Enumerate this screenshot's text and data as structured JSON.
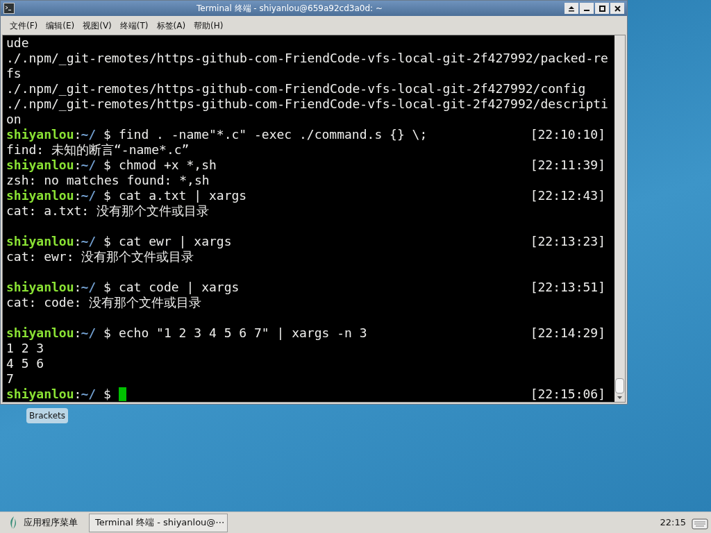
{
  "window": {
    "title": "Terminal 终端 - shiyanlou@659a92cd3a0d: ~"
  },
  "menu": [
    "文件(F)",
    "编辑(E)",
    "视图(V)",
    "终端(T)",
    "标签(A)",
    "帮助(H)"
  ],
  "terminal": {
    "lines": [
      {
        "kind": "output",
        "text": "ude"
      },
      {
        "kind": "output",
        "text": "./.npm/_git-remotes/https-github-com-FriendCode-vfs-local-git-2f427992/packed-re"
      },
      {
        "kind": "output",
        "text": "fs"
      },
      {
        "kind": "output",
        "text": "./.npm/_git-remotes/https-github-com-FriendCode-vfs-local-git-2f427992/config"
      },
      {
        "kind": "output",
        "text": "./.npm/_git-remotes/https-github-com-FriendCode-vfs-local-git-2f427992/descripti"
      },
      {
        "kind": "output",
        "text": "on"
      },
      {
        "kind": "prompt",
        "user": "shiyanlou",
        "sep": ":",
        "path": "~/",
        "sign": "$",
        "command": "find . -name\"*.c\" -exec ./command.s {} \\;",
        "time": "[22:10:10]"
      },
      {
        "kind": "output",
        "text": "find: 未知的断言“-name*.c”"
      },
      {
        "kind": "prompt",
        "user": "shiyanlou",
        "sep": ":",
        "path": "~/",
        "sign": "$",
        "command": "chmod +x *,sh",
        "time": "[22:11:39]"
      },
      {
        "kind": "output",
        "text": "zsh: no matches found: *,sh"
      },
      {
        "kind": "prompt",
        "user": "shiyanlou",
        "sep": ":",
        "path": "~/",
        "sign": "$",
        "command": "cat a.txt | xargs",
        "time": "[22:12:43]"
      },
      {
        "kind": "output",
        "text": "cat: a.txt: 没有那个文件或目录"
      },
      {
        "kind": "blank"
      },
      {
        "kind": "prompt",
        "user": "shiyanlou",
        "sep": ":",
        "path": "~/",
        "sign": "$",
        "command": "cat ewr | xargs",
        "time": "[22:13:23]"
      },
      {
        "kind": "output",
        "text": "cat: ewr: 没有那个文件或目录"
      },
      {
        "kind": "blank"
      },
      {
        "kind": "prompt",
        "user": "shiyanlou",
        "sep": ":",
        "path": "~/",
        "sign": "$",
        "command": "cat code | xargs",
        "time": "[22:13:51]"
      },
      {
        "kind": "output",
        "text": "cat: code: 没有那个文件或目录"
      },
      {
        "kind": "blank"
      },
      {
        "kind": "prompt",
        "user": "shiyanlou",
        "sep": ":",
        "path": "~/",
        "sign": "$",
        "command": "echo \"1 2 3 4 5 6 7\" | xargs -n 3",
        "time": "[22:14:29]"
      },
      {
        "kind": "output",
        "text": "1 2 3"
      },
      {
        "kind": "output",
        "text": "4 5 6"
      },
      {
        "kind": "output",
        "text": "7"
      },
      {
        "kind": "prompt",
        "user": "shiyanlou",
        "sep": ":",
        "path": "~/",
        "sign": "$",
        "cursor": true,
        "time": "[22:15:06]"
      }
    ]
  },
  "desktop_icon": {
    "label": "Brackets"
  },
  "taskbar": {
    "app_menu": "应用程序菜单",
    "task": "Terminal 终端 - shiyanlou@⋯",
    "clock": "22:15"
  }
}
